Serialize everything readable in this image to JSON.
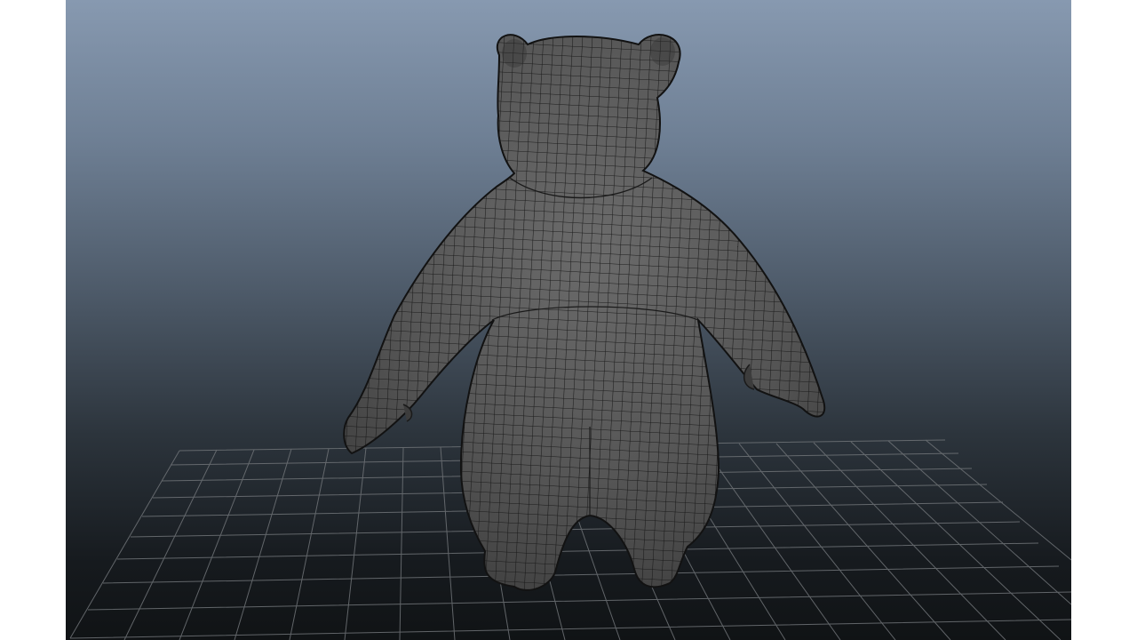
{
  "viewport": {
    "view": "3d-perspective",
    "display_mode": "smooth-shade-wireframe-on-shaded",
    "background_top_color": "#8799b0",
    "background_bottom_color": "#101315"
  },
  "ground_grid": {
    "visible": true,
    "line_color": "#6f7377"
  },
  "model": {
    "name": "bear",
    "view_side": "back",
    "surface_color": "#5a5a5a",
    "wire_color": "#151515"
  }
}
